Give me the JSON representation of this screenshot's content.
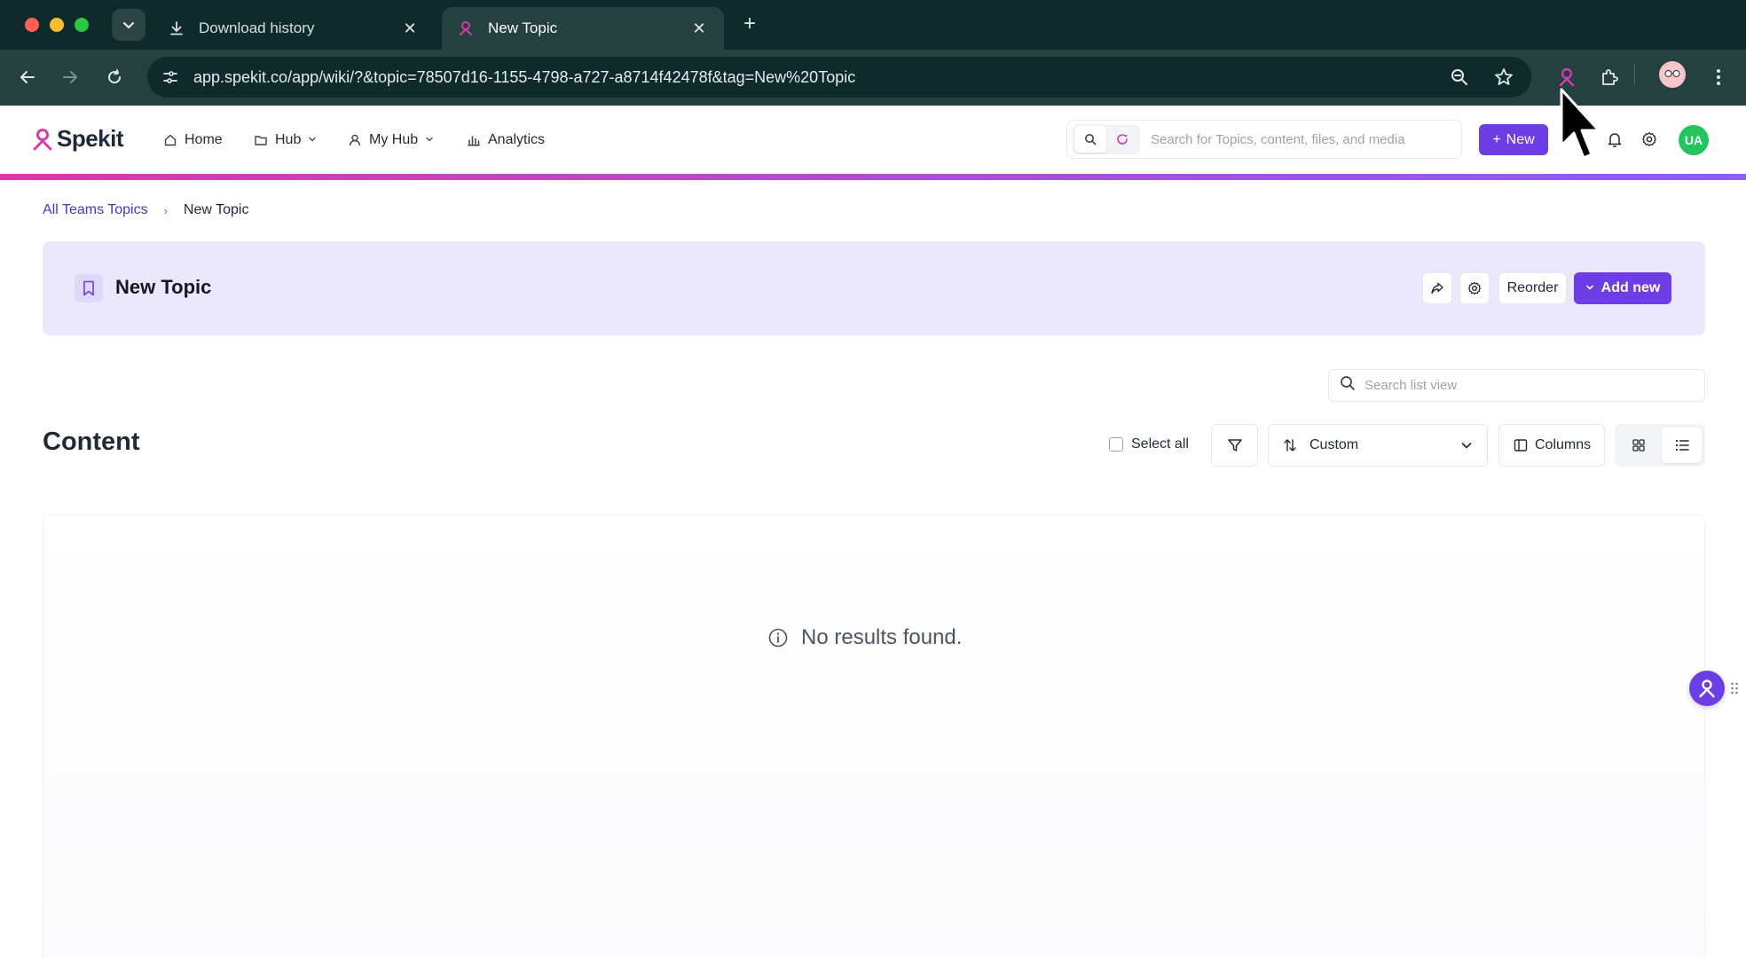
{
  "browser": {
    "tabs": [
      {
        "title": "Download history",
        "active": false,
        "icon": "download-icon"
      },
      {
        "title": "New Topic",
        "active": true,
        "icon": "spekit-favicon"
      }
    ],
    "close_glyph": "✕",
    "new_tab_glyph": "+",
    "menu_glyph": "⌄",
    "url": "app.spekit.co/app/wiki/?&topic=78507d16-1155-4798-a727-a8714f42478f&tag=New%20Topic"
  },
  "app": {
    "brand": "Spekit",
    "nav": [
      {
        "label": "Home",
        "icon": "home-icon",
        "has_dropdown": false
      },
      {
        "label": "Hub",
        "icon": "folder-icon",
        "has_dropdown": true
      },
      {
        "label": "My Hub",
        "icon": "user-icon",
        "has_dropdown": true
      },
      {
        "label": "Analytics",
        "icon": "bar-chart-icon",
        "has_dropdown": false
      }
    ],
    "search_placeholder": "Search for Topics, content, files, and media",
    "new_button": "New",
    "new_button_glyph": "+",
    "avatar_initials": "UA",
    "accent_color": "#6d3ee6",
    "brand_gradient": [
      "#d63bab",
      "#8b5cf6"
    ]
  },
  "breadcrumb": {
    "parent": "All Teams Topics",
    "separator": "›",
    "current": "New Topic"
  },
  "topic": {
    "title": "New Topic",
    "reorder_label": "Reorder",
    "add_new_label": "Add new",
    "add_new_glyph": "⌄"
  },
  "list": {
    "search_placeholder": "Search list view",
    "heading": "Content",
    "select_all_label": "Select all",
    "sort_value": "Custom",
    "columns_label": "Columns",
    "view_mode": "grid",
    "empty_message": "No results found."
  }
}
